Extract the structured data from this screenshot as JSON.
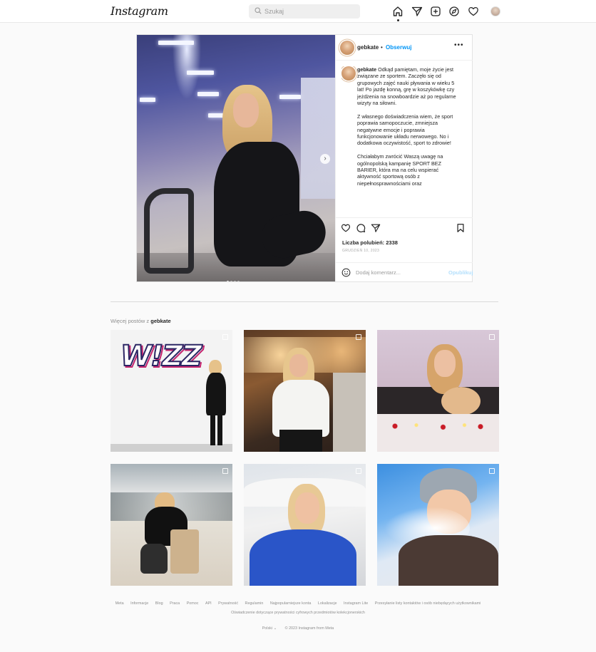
{
  "nav": {
    "logo": "Instagram",
    "search_placeholder": "Szukaj",
    "icons": [
      "home-icon",
      "direct-icon",
      "new-post-icon",
      "explore-icon",
      "activity-heart-icon",
      "profile-avatar"
    ]
  },
  "post": {
    "username": "gebkate",
    "separator": "•",
    "follow_label": "Obserwuj",
    "more_label": "•••",
    "caption_user": "gebkate",
    "caption_paragraphs": [
      "Odkąd pamiętam, moje życie jest związane ze sportem. Zaczęło się od grupowych zajęć nauki pływania w wieku 5 lat! Po jazdę konną, grę w koszykówkę czy jeżdżenia na snowboardzie aż po regularne wizyty na siłowni.",
      "Z własnego doświadczenia wiem, że sport poprawia samopoczucie, zmniejsza negatywne emocje i poprawia funkcjonowanie układu nerwowego. No i dodatkowa oczywistość, sport to zdrowie!",
      "Chciałabym zwrócić Waszą uwagę na ogólnopolską kampanię SPORT BEZ BARIER, która ma na celu wspierać aktywność sportową osób z niepełnosprawnościami oraz"
    ],
    "likes_text": "Liczba polubień: 2338",
    "date_text": "GRUDZIEŃ 10, 2023",
    "comment_placeholder": "Dodaj komentarz...",
    "publish_label": "Opublikuj",
    "carousel_count": 4,
    "carousel_active": 0
  },
  "more_posts": {
    "prefix": "Więcej postów z",
    "username": "gebkate",
    "tiles": [
      {
        "name": "grid-post-wizz",
        "logo_text": "W!ZZ",
        "multi": true
      },
      {
        "name": "grid-post-restaurant",
        "multi": true
      },
      {
        "name": "grid-post-cat",
        "multi": true
      },
      {
        "name": "grid-post-airport",
        "multi": true
      },
      {
        "name": "grid-post-plane",
        "multi": true
      },
      {
        "name": "grid-post-winter",
        "multi": true
      }
    ]
  },
  "footer": {
    "links": [
      "Meta",
      "Informacje",
      "Blog",
      "Praca",
      "Pomoc",
      "API",
      "Prywatność",
      "Regulamin",
      "Najpopularniejsze konta",
      "Lokalizacje",
      "Instagram Lite",
      "Przesyłanie listy kontaktów i osób niebędących użytkownikami"
    ],
    "line2": "Oświadczenie dotyczące prywatności cyfrowych przedmiotów kolekcjonerskich",
    "language": "Polski ⌄",
    "copyright": "© 2023 Instagram from Meta"
  },
  "colors": {
    "accent": "#0095f6",
    "publish_disabled": "#b2dffc",
    "text": "#262626",
    "muted": "#8e8e8e"
  }
}
